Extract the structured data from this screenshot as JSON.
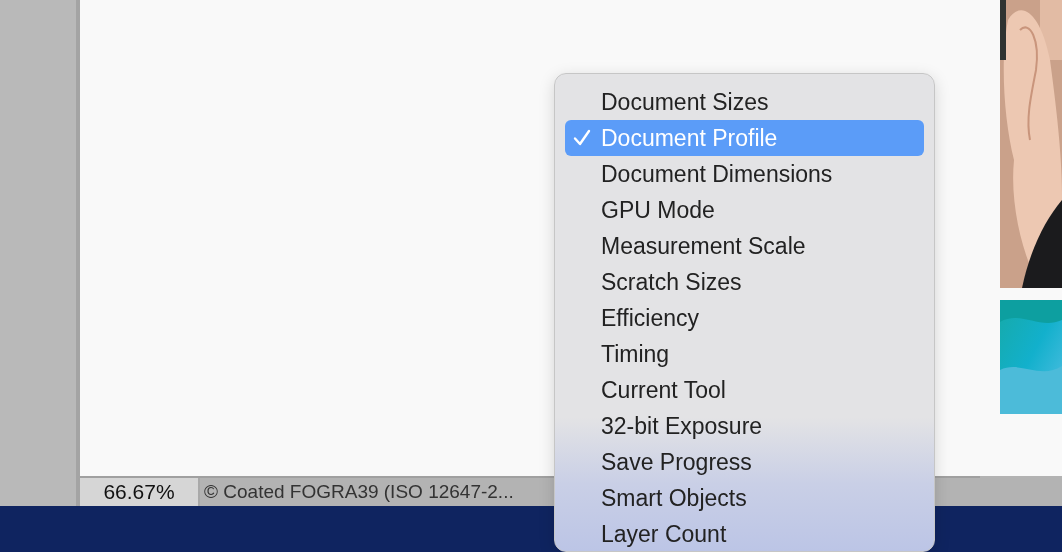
{
  "status_bar": {
    "zoom": "66.67%",
    "info": "© Coated FOGRA39 (ISO 12647-2..."
  },
  "menu": {
    "items": [
      {
        "label": "Document Sizes",
        "checked": false,
        "selected": false
      },
      {
        "label": "Document Profile",
        "checked": true,
        "selected": true
      },
      {
        "label": "Document Dimensions",
        "checked": false,
        "selected": false
      },
      {
        "label": "GPU Mode",
        "checked": false,
        "selected": false
      },
      {
        "label": "Measurement Scale",
        "checked": false,
        "selected": false
      },
      {
        "label": "Scratch Sizes",
        "checked": false,
        "selected": false
      },
      {
        "label": "Efficiency",
        "checked": false,
        "selected": false
      },
      {
        "label": "Timing",
        "checked": false,
        "selected": false
      },
      {
        "label": "Current Tool",
        "checked": false,
        "selected": false
      },
      {
        "label": "32-bit Exposure",
        "checked": false,
        "selected": false
      },
      {
        "label": "Save Progress",
        "checked": false,
        "selected": false
      },
      {
        "label": "Smart Objects",
        "checked": false,
        "selected": false
      },
      {
        "label": "Layer Count",
        "checked": false,
        "selected": false
      }
    ]
  }
}
